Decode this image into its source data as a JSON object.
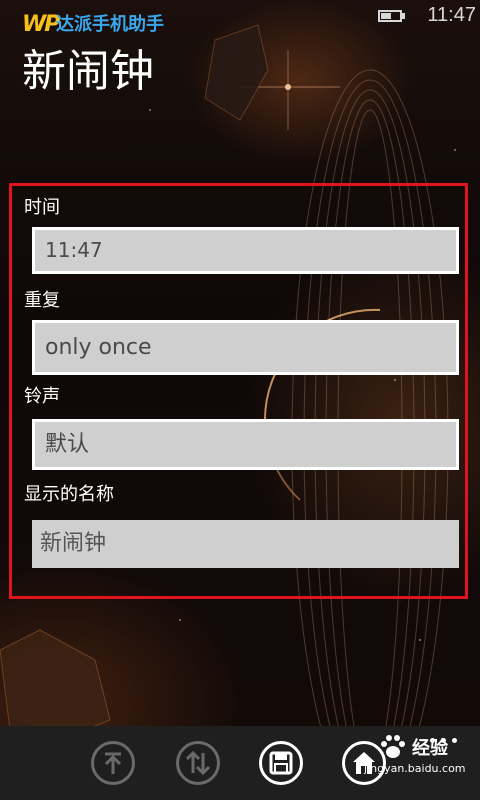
{
  "status_bar": {
    "time": "11:47",
    "battery_icon": "battery-icon"
  },
  "brand": {
    "logo_text": "WP",
    "name": "达派手机助手"
  },
  "page": {
    "title": "新闹钟"
  },
  "form": {
    "time": {
      "label": "时间",
      "value": "11:47"
    },
    "repeat": {
      "label": "重复",
      "value": "only once"
    },
    "ringtone": {
      "label": "铃声",
      "value": "默认"
    },
    "name": {
      "label": "显示的名称",
      "placeholder": "新闹钟"
    }
  },
  "app_bar": {
    "buttons": [
      {
        "icon": "scroll-to-top-icon"
      },
      {
        "icon": "sort-icon"
      },
      {
        "icon": "save-icon"
      },
      {
        "icon": "home-icon"
      }
    ],
    "more_icon": "more-dots-icon"
  },
  "watermark": {
    "site_name": "经验",
    "site_url": "jingyan.baidu.com"
  },
  "colors": {
    "highlight_frame": "#e0141e",
    "brand_blue": "#3aa8ef",
    "brand_yellow": "#f6c21a",
    "field_bg": "#cfcfcf",
    "app_bar_bg": "#1f1f1f"
  }
}
